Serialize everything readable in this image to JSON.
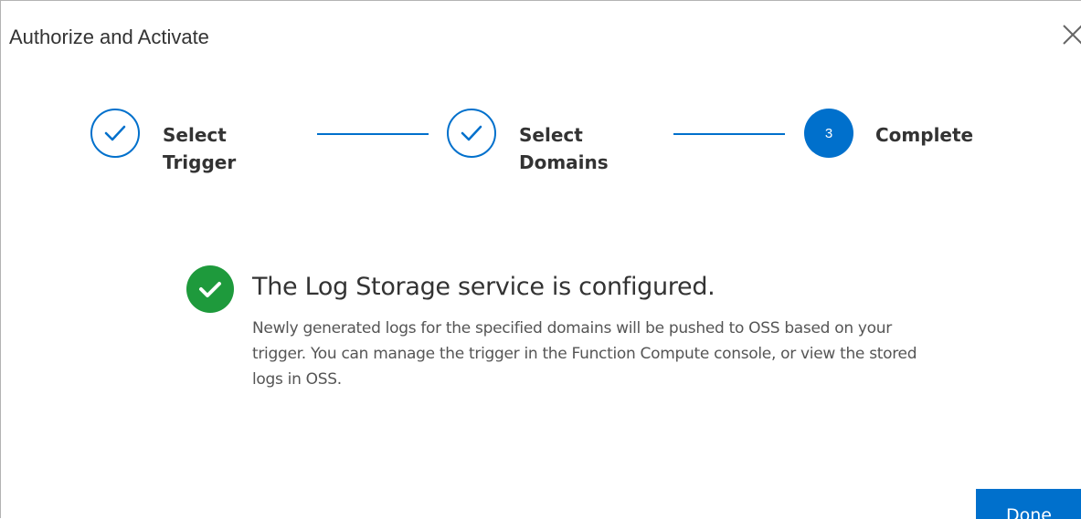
{
  "dialog": {
    "title": "Authorize and Activate",
    "close_icon": "close-icon"
  },
  "steps": [
    {
      "label": "Select\nTrigger",
      "state": "done",
      "icon": "check-icon"
    },
    {
      "label": "Select\nDomains",
      "state": "done",
      "icon": "check-icon"
    },
    {
      "label": "Complete",
      "state": "active",
      "number": "3"
    }
  ],
  "result": {
    "icon": "success-check-icon",
    "title": "The Log Storage service is configured.",
    "description": "Newly generated logs for the specified domains will be pushed to OSS based on your trigger. You can manage the trigger in the Function Compute console, or view the stored logs in OSS."
  },
  "footer": {
    "done_label": "Done"
  },
  "colors": {
    "primary": "#0070cc",
    "success": "#1e9a3c"
  }
}
